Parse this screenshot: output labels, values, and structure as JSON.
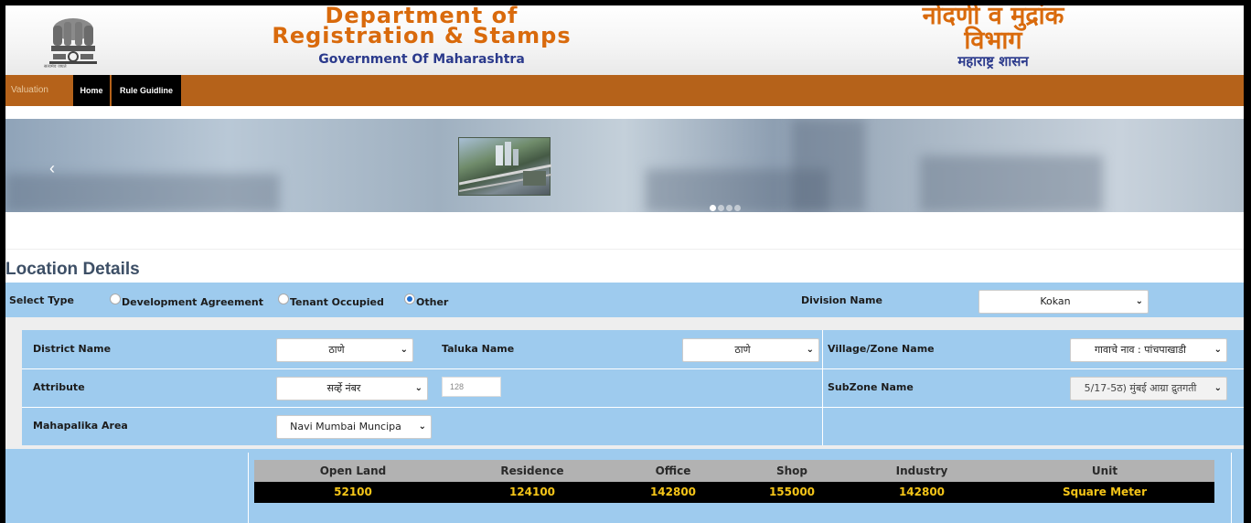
{
  "header": {
    "title_line1": "Department of",
    "title_line2": "Registration & Stamps",
    "subtitle": "Government Of Maharashtra",
    "title_mr_line1": "नोंदणी व मुद्रांक",
    "title_mr_line2": "विभाग",
    "subtitle_mr": "महाराष्ट्र शासन",
    "emblem_motto": "सत्यमेव जयते",
    "emblem_icon": "state-emblem-icon"
  },
  "nav": {
    "brand": "Valuation",
    "items": [
      {
        "label": "Home"
      },
      {
        "label": "Rule Guidline"
      }
    ]
  },
  "carousel": {
    "prev_icon": "chevron-left-icon",
    "prev_glyph": "‹",
    "slide_count": 4,
    "active_slide": 1
  },
  "location": {
    "heading": "Location Details",
    "select_type_label": "Select Type",
    "types": [
      {
        "label": "Development Agreement",
        "checked": false
      },
      {
        "label": "Tenant Occupied",
        "checked": false
      },
      {
        "label": "Other",
        "checked": true
      }
    ],
    "division_label": "Division Name",
    "division_value": "Kokan",
    "district_label": "District Name",
    "district_value": "ठाणे",
    "taluka_label": "Taluka Name",
    "taluka_value": "ठाणे",
    "village_label": "Village/Zone Name",
    "village_value": "गावाचे नाव : पांचपाखाडी",
    "attribute_label": "Attribute",
    "attribute_value": "सर्व्हे नंबर",
    "attribute_input": "128",
    "subzone_label": "SubZone Name",
    "subzone_value": "5/17-5ठ) मुंबई आग्रा द्रुतगती",
    "mahapalika_label": "Mahapalika Area",
    "mahapalika_value": "Navi Mumbai Muncipa"
  },
  "rates": {
    "headers": [
      "Open Land",
      "Residence",
      "Office",
      "Shop",
      "Industry",
      "Unit"
    ],
    "values": [
      "52100",
      "124100",
      "142800",
      "155000",
      "142800",
      "Square Meter"
    ]
  },
  "colors": {
    "brand_orange": "#d96a0c",
    "nav_brown": "#b5621a",
    "panel_blue": "#9ecbee",
    "rate_yellow": "#f5c518",
    "title_blue": "#2b3a8c"
  }
}
